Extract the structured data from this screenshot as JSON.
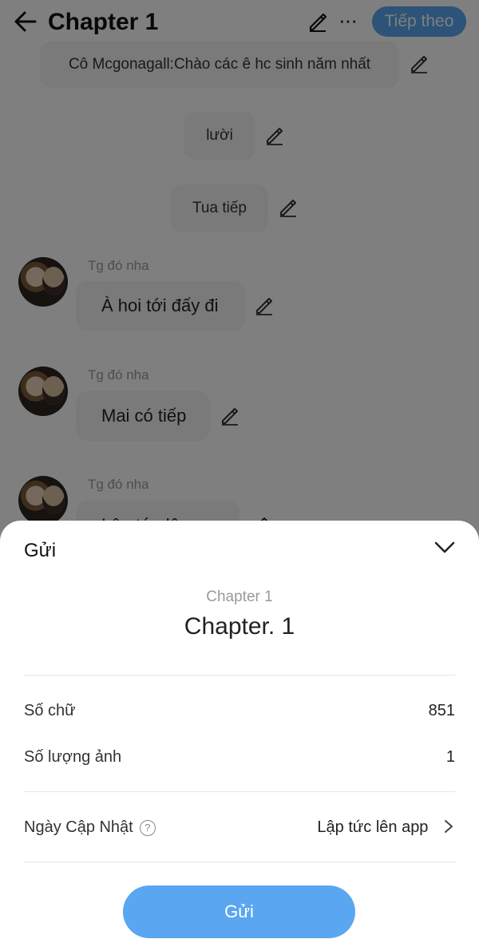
{
  "header": {
    "title": "Chapter 1",
    "next_label": "Tiếp theo",
    "more_label": "···"
  },
  "chat": {
    "messages": [
      {
        "text": "Cô Mcgonagall:Chào các ê hc sinh năm nhất"
      },
      {
        "text": "lười"
      },
      {
        "text": "Tua tiếp"
      },
      {
        "author": "Tg đó nha",
        "text": "À hoi tới đấy đi"
      },
      {
        "author": "Tg đó nha",
        "text": "Mai có tiếp"
      },
      {
        "author": "Tg đó nha",
        "text": "Lập tức lên app"
      }
    ]
  },
  "sheet": {
    "title": "Gửi",
    "subtitle": "Chapter 1",
    "chapter_title": "Chapter. 1",
    "word_count_label": "Số chữ",
    "word_count_value": "851",
    "image_count_label": "Số lượng ảnh",
    "image_count_value": "1",
    "update_label": "Ngày Cập Nhật",
    "help_symbol": "?",
    "update_value": "Lập tức lên app",
    "send_label": "Gửi"
  },
  "colors": {
    "accent": "#5aa6f1",
    "overlay": "rgba(0,0,0,0.5)"
  },
  "icons": [
    "back-arrow-icon",
    "edit-pencil-icon",
    "more-icon",
    "chevron-down-icon",
    "chevron-right-icon",
    "help-icon"
  ]
}
